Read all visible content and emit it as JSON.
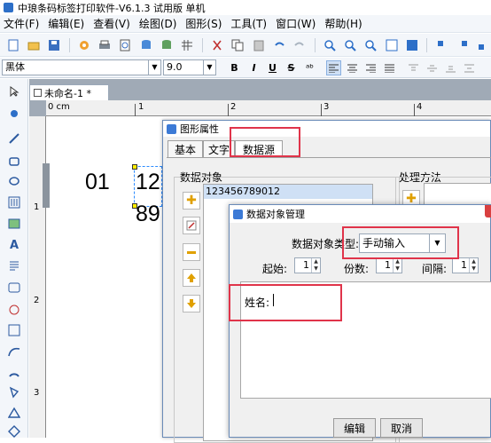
{
  "app": {
    "title": "中琅条码标签打印软件-V6.1.3 试用版 单机"
  },
  "menu": [
    "文件(F)",
    "编辑(E)",
    "查看(V)",
    "绘图(D)",
    "图形(S)",
    "工具(T)",
    "窗口(W)",
    "帮助(H)"
  ],
  "font_bar": {
    "font_name": "黑体",
    "font_size": "9.0",
    "bold": "B",
    "italic": "I",
    "underline": "U",
    "strike": "S"
  },
  "document": {
    "tab_title": "未命名-1 *"
  },
  "ruler": {
    "unit": "0 cm",
    "h_marks": [
      "1",
      "2",
      "3",
      "4"
    ],
    "v_marks": [
      "1",
      "2",
      "3"
    ]
  },
  "canvas": {
    "text_left": "01",
    "text_main": "12",
    "text_line2": "89"
  },
  "dialog_props": {
    "title": "图形属性",
    "tabs": [
      "基本",
      "文字",
      "数据源"
    ],
    "data_objects_label": "数据对象",
    "data_object_item": "123456789012",
    "processing_label": "处理方法"
  },
  "dialog_data": {
    "title": "数据对象管理",
    "type_label": "数据对象类型:",
    "type_value": "手动输入",
    "start_label": "起始:",
    "start_value": "1",
    "copies_label": "份数:",
    "copies_value": "1",
    "interval_label": "间隔:",
    "interval_value": "1",
    "content": "姓名: ",
    "edit_button": "编辑",
    "cancel_button": "取消"
  },
  "colors": {
    "highlight": "#e0344a",
    "selection": "#2d8cff",
    "title_accent": "#3c7ad6"
  }
}
